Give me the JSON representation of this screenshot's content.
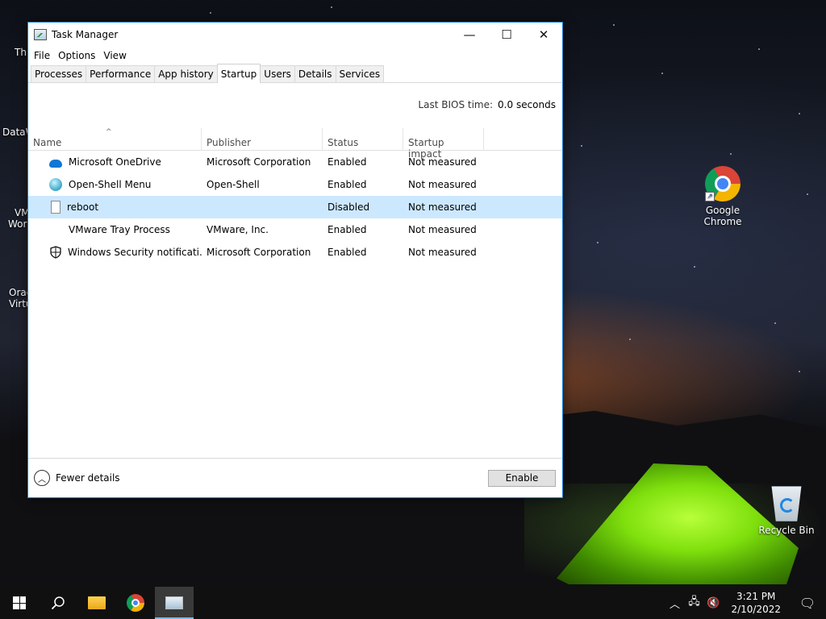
{
  "desktop": {
    "icons": [
      {
        "label": "Google\nChrome",
        "icon": "chrome-icon"
      },
      {
        "label": "Recycle Bin",
        "icon": "recycle-bin-icon"
      }
    ],
    "partial_labels": [
      "Th",
      "DataW",
      "VM",
      "Worl",
      "Orac",
      "Virtu"
    ]
  },
  "window": {
    "title": "Task Manager",
    "controls": {
      "minimize": "—",
      "maximize": "☐",
      "close": "✕"
    },
    "menu": [
      "File",
      "Options",
      "View"
    ],
    "tabs": [
      "Processes",
      "Performance",
      "App history",
      "Startup",
      "Users",
      "Details",
      "Services"
    ],
    "active_tab": "Startup",
    "bios_label": "Last BIOS time:",
    "bios_value": "0.0 seconds",
    "columns": [
      "Name",
      "Publisher",
      "Status",
      "Startup impact"
    ],
    "rows": [
      {
        "icon": "onedrive-icon",
        "name": "Microsoft OneDrive",
        "publisher": "Microsoft Corporation",
        "status": "Enabled",
        "impact": "Not measured"
      },
      {
        "icon": "open-shell-icon",
        "name": "Open-Shell Menu",
        "publisher": "Open-Shell",
        "status": "Enabled",
        "impact": "Not measured"
      },
      {
        "icon": "file-icon",
        "name": "reboot",
        "publisher": "",
        "status": "Disabled",
        "impact": "Not measured",
        "selected": true
      },
      {
        "icon": "blank-icon",
        "name": "VMware Tray Process",
        "publisher": "VMware, Inc.",
        "status": "Enabled",
        "impact": "Not measured"
      },
      {
        "icon": "shield-icon",
        "name": "Windows Security notificati...",
        "publisher": "Microsoft Corporation",
        "status": "Enabled",
        "impact": "Not measured"
      }
    ],
    "footer": {
      "fewer_details": "Fewer details",
      "enable_button": "Enable"
    }
  },
  "taskbar": {
    "clock_time": "3:21 PM",
    "clock_date": "2/10/2022"
  }
}
